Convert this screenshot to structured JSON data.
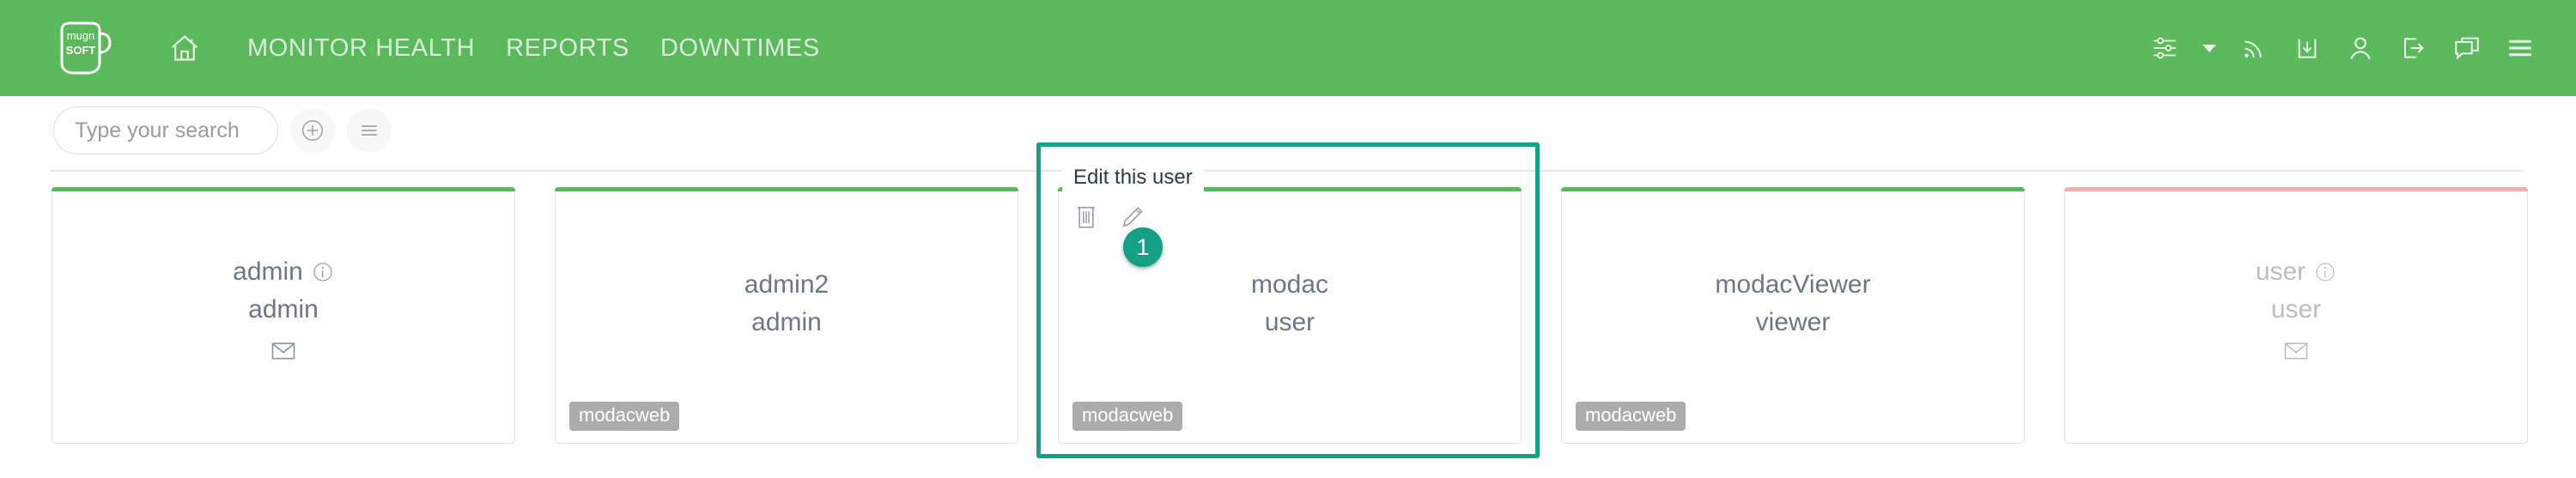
{
  "brand": {
    "logo_line1": "mugn",
    "logo_line2": "SOFT",
    "header_color": "#5cb85c"
  },
  "header": {
    "nav_items": [
      {
        "label": "MONITOR HEALTH",
        "name": "nav-monitor-health"
      },
      {
        "label": "REPORTS",
        "name": "nav-reports"
      },
      {
        "label": "DOWNTIMES",
        "name": "nav-downtimes"
      }
    ],
    "icons": [
      {
        "name": "settings-sliders-icon"
      },
      {
        "name": "chevron-down-icon"
      },
      {
        "name": "rss-feed-icon"
      },
      {
        "name": "download-icon"
      },
      {
        "name": "user-account-icon"
      },
      {
        "name": "logout-icon"
      },
      {
        "name": "chat-icon"
      },
      {
        "name": "hamburger-menu-icon"
      }
    ]
  },
  "toolbar": {
    "search_placeholder": "Type your search",
    "search_value": "",
    "add_label": "+",
    "list_label": "☰"
  },
  "annotation": {
    "tooltip": "Edit this user",
    "badge_number": "1",
    "accent_color": "#16a085"
  },
  "cards": [
    {
      "name": "admin",
      "role": "admin",
      "accent": "#5cb85c",
      "has_info": true,
      "has_mail": true,
      "tag": "",
      "disabled": false,
      "highlighted": false
    },
    {
      "name": "admin2",
      "role": "admin",
      "accent": "#5cb85c",
      "has_info": false,
      "has_mail": false,
      "tag": "modacweb",
      "disabled": false,
      "highlighted": false
    },
    {
      "name": "modac",
      "role": "user",
      "accent": "#5cb85c",
      "has_info": false,
      "has_mail": false,
      "tag": "modacweb",
      "disabled": false,
      "highlighted": true,
      "actions": [
        {
          "name": "delete-user-icon",
          "title": "Delete this user"
        },
        {
          "name": "edit-user-icon",
          "title": "Edit this user"
        }
      ]
    },
    {
      "name": "modacViewer",
      "role": "viewer",
      "accent": "#5cb85c",
      "has_info": false,
      "has_mail": false,
      "tag": "modacweb",
      "disabled": false,
      "highlighted": false
    },
    {
      "name": "user",
      "role": "user",
      "accent": "#efb0ae",
      "has_info": true,
      "has_mail": true,
      "tag": "",
      "disabled": true,
      "highlighted": false
    }
  ]
}
